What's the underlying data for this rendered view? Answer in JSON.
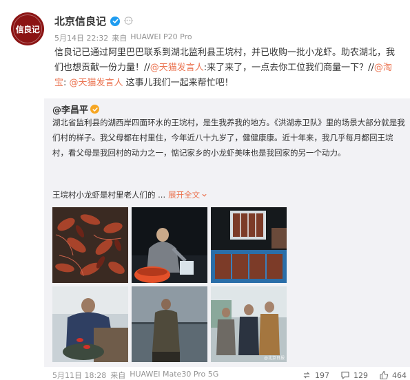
{
  "post": {
    "author": "北京信良记",
    "avatar_logo_text": "信良记",
    "meta": {
      "time": "5月14日 22:32",
      "source_prefix": "来自",
      "device": "HUAWEI P20 Pro"
    },
    "content": {
      "text_1": "信良记已通过阿里巴巴联系到湖北监利县王垸村，并已收购一批小龙虾。助农湖北，我们也想贡献一份力量！//",
      "mention_1": "@天猫发言人",
      "text_2": ":来了来了，一点去你工位我们商量一下？//",
      "mention_2": "@淘宝",
      "text_3": ": ",
      "mention_3": "@天猫发言人",
      "text_4": " 这事儿我们一起来帮忙吧！"
    }
  },
  "repost": {
    "author": "@李昌平",
    "text": "湖北省监利县的湖西岸四面环水的王垸村，是生我养我的地方。《洪湖赤卫队》里的场景大部分就是我们村的样子。我父母都在村里住，今年近八十九岁了，健健康康。近十年来，我几乎每月都回王垸村，看父母是我回村的动力之一，惦记家乡的小龙虾美味也是我回家的另一个动力。",
    "summary": "王垸村小龙虾是村里老人们的 ...",
    "expand_label": "展开全文",
    "photos": [
      {
        "name": "crayfish-pile-photo"
      },
      {
        "name": "night-harvest-photo"
      },
      {
        "name": "crayfish-crates-photo"
      },
      {
        "name": "fisherman-boat-photo"
      },
      {
        "name": "lakeside-man-photo"
      },
      {
        "name": "villagers-group-photo"
      }
    ],
    "watermark": "@北京日报",
    "footer": {
      "time": "5月11日 18:28",
      "source_prefix": "来自",
      "device": "HUAWEI Mate30 Pro 5G",
      "reposts": "197",
      "comments": "129",
      "likes": "464"
    }
  },
  "colors": {
    "mention": "#eb7350",
    "verified_blue": "#1e9cf0",
    "verified_gold": "#f6a623",
    "repost_bg": "#f2f2f5",
    "avatar_red": "#8b1414"
  }
}
